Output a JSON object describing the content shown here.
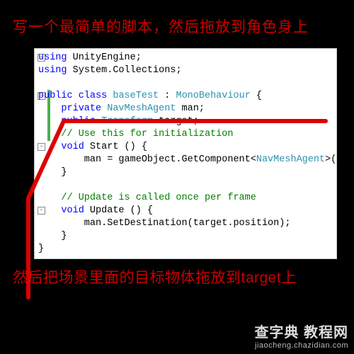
{
  "captions": {
    "top": "写一个最简单的脚本，然后拖放到角色身上",
    "bottom": "然后把场景里面的目标物体拖放到target上"
  },
  "code": {
    "lines": [
      {
        "seg": [
          {
            "c": "t-key",
            "t": "using"
          },
          {
            "c": "",
            "t": " UnityEngine;"
          }
        ],
        "fold": "-",
        "bar": false
      },
      {
        "seg": [
          {
            "c": "t-key",
            "t": "using"
          },
          {
            "c": "",
            "t": " System.Collections;"
          }
        ],
        "fold": null,
        "bar": false
      },
      {
        "seg": [
          {
            "c": "",
            "t": ""
          }
        ],
        "fold": null,
        "bar": false
      },
      {
        "seg": [
          {
            "c": "t-key",
            "t": "public"
          },
          {
            "c": "",
            "t": " "
          },
          {
            "c": "t-key",
            "t": "class"
          },
          {
            "c": "",
            "t": " "
          },
          {
            "c": "t-cls",
            "t": "baseTest"
          },
          {
            "c": "",
            "t": " : "
          },
          {
            "c": "t-type",
            "t": "MonoBehaviour"
          },
          {
            "c": "",
            "t": " {"
          }
        ],
        "fold": "-",
        "bar": true
      },
      {
        "seg": [
          {
            "c": "",
            "t": "    "
          },
          {
            "c": "t-key",
            "t": "private"
          },
          {
            "c": "",
            "t": " "
          },
          {
            "c": "t-type",
            "t": "NavMeshAgent"
          },
          {
            "c": "",
            "t": " man;"
          }
        ],
        "fold": null,
        "bar": true
      },
      {
        "seg": [
          {
            "c": "",
            "t": "    "
          },
          {
            "c": "t-key",
            "t": "public"
          },
          {
            "c": "",
            "t": " "
          },
          {
            "c": "t-type",
            "t": "Transform"
          },
          {
            "c": "",
            "t": " target;"
          }
        ],
        "fold": null,
        "bar": true
      },
      {
        "seg": [
          {
            "c": "",
            "t": "    "
          },
          {
            "c": "t-cmt",
            "t": "// Use this for initialization"
          }
        ],
        "fold": null,
        "bar": true
      },
      {
        "seg": [
          {
            "c": "",
            "t": "    "
          },
          {
            "c": "t-key",
            "t": "void"
          },
          {
            "c": "",
            "t": " Start () {"
          }
        ],
        "fold": "-",
        "bar": false
      },
      {
        "seg": [
          {
            "c": "",
            "t": "        man = gameObject.GetComponent<"
          },
          {
            "c": "t-type",
            "t": "NavMeshAgent"
          },
          {
            "c": "",
            "t": ">();"
          }
        ],
        "fold": null,
        "bar": false
      },
      {
        "seg": [
          {
            "c": "",
            "t": "    }"
          }
        ],
        "fold": null,
        "bar": false
      },
      {
        "seg": [
          {
            "c": "",
            "t": ""
          }
        ],
        "fold": null,
        "bar": false
      },
      {
        "seg": [
          {
            "c": "",
            "t": "    "
          },
          {
            "c": "t-cmt",
            "t": "// Update is called once per frame"
          }
        ],
        "fold": null,
        "bar": false
      },
      {
        "seg": [
          {
            "c": "",
            "t": "    "
          },
          {
            "c": "t-key",
            "t": "void"
          },
          {
            "c": "",
            "t": " Update () {"
          }
        ],
        "fold": "-",
        "bar": false
      },
      {
        "seg": [
          {
            "c": "",
            "t": "        man.SetDestination(target.position);"
          }
        ],
        "fold": null,
        "bar": false
      },
      {
        "seg": [
          {
            "c": "",
            "t": "    }"
          }
        ],
        "fold": null,
        "bar": false
      },
      {
        "seg": [
          {
            "c": "",
            "t": "}"
          }
        ],
        "fold": null,
        "bar": false
      }
    ]
  },
  "watermark": {
    "brand": "查字典 教程网",
    "url": "jiaocheng.chazidian.com"
  }
}
